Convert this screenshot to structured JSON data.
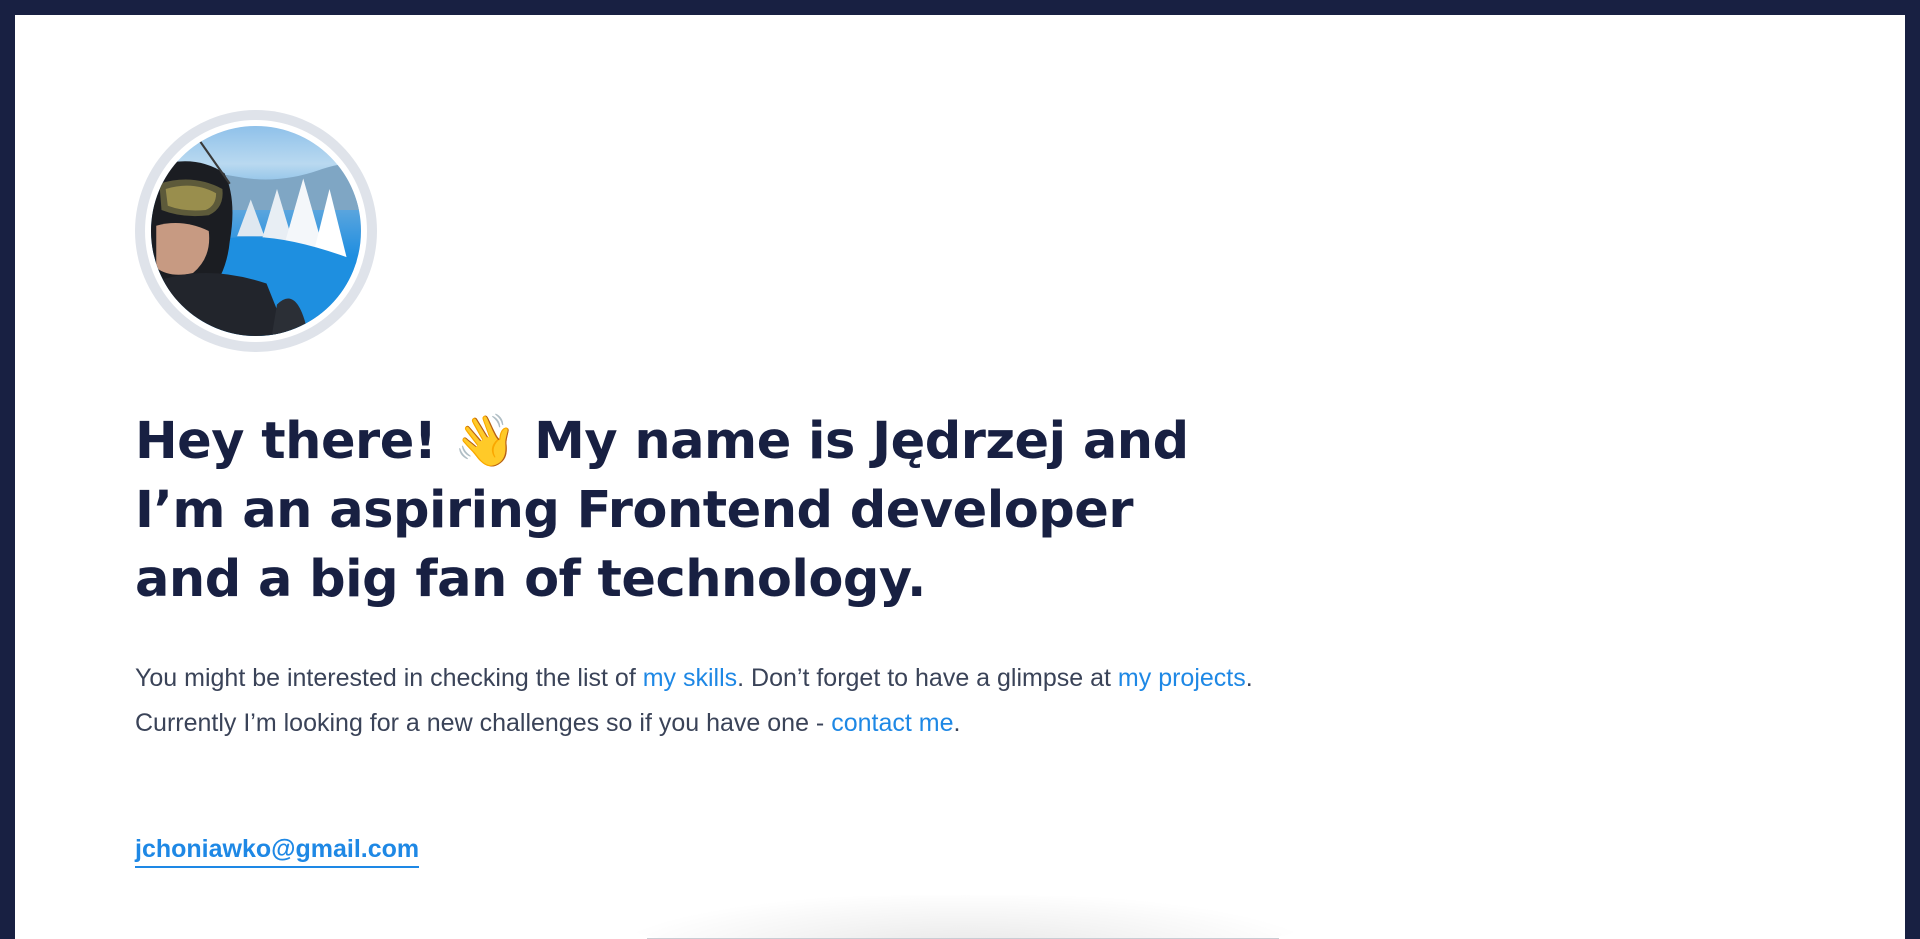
{
  "profile": {
    "avatar_alt": "Profile photo on a snowy mountain slope"
  },
  "hero": {
    "headline_part1": "Hey there! ",
    "wave_emoji": "👋",
    "headline_part2": " My name is Jędrzej and I’m an aspiring Frontend developer and a big fan of technology."
  },
  "intro": {
    "text_1": "You might be interested in checking the list of ",
    "link_skills": "my skills",
    "text_2": ". Don’t forget to have a glimpse at ",
    "link_projects": "my projects",
    "text_3": ". Currently I’m looking for a new challenges so if you have one - ",
    "link_contact": "contact me",
    "text_4": "."
  },
  "contact": {
    "email": "jchoniawko@gmail.com"
  },
  "colors": {
    "background_dark": "#182042",
    "text_dark": "#182042",
    "link_blue": "#1e88e5",
    "body_text": "#3a4358"
  }
}
